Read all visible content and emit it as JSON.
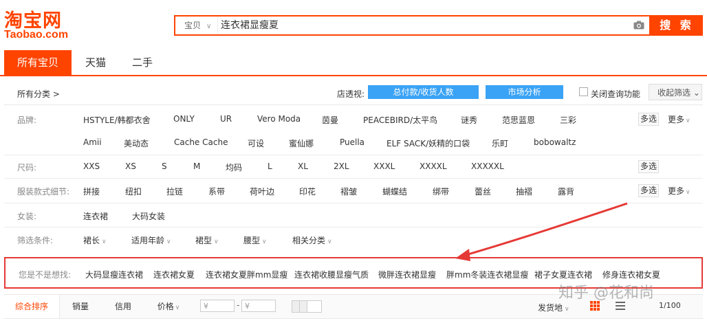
{
  "logo": {
    "cn": "淘宝网",
    "en": "Taobao.com"
  },
  "search": {
    "scope": "宝贝",
    "query": "连衣裙显瘦夏",
    "button": "搜 索"
  },
  "tabs": [
    "所有宝贝",
    "天猫",
    "二手"
  ],
  "breadcrumb": "所有分类 >",
  "store_view": {
    "label": "店透视:",
    "btn1": "总付款/收货人数",
    "btn2": "市场分析"
  },
  "close_query": "关闭查询功能",
  "collapse": "收起筛选 ⌄",
  "filters": {
    "brand": {
      "label": "品牌:",
      "row1": [
        "HSTYLE/韩都衣舍",
        "ONLY",
        "UR",
        "Vero Moda",
        "茵曼",
        "PEACEBIRD/太平鸟",
        "谜秀",
        "范思蓝恩",
        "三彩"
      ],
      "row2": [
        "Amii",
        "美动态",
        "Cache Cache",
        "可设",
        "蜜仙娜",
        "Puella",
        "ELF SACK/妖精的口袋",
        "乐町",
        "bobowaltz"
      ]
    },
    "size": {
      "label": "尺码:",
      "items": [
        "XXS",
        "XS",
        "S",
        "M",
        "均码",
        "L",
        "XL",
        "2XL",
        "XXXL",
        "XXXXL",
        "XXXXXL"
      ]
    },
    "detail": {
      "label": "服装款式细节:",
      "items": [
        "拼接",
        "纽扣",
        "拉链",
        "系带",
        "荷叶边",
        "印花",
        "褶皱",
        "蝴蝶结",
        "绑带",
        "蕾丝",
        "抽褶",
        "露背"
      ]
    },
    "womens": {
      "label": "女装:",
      "items": [
        "连衣裙",
        "大码女装"
      ]
    },
    "conditions": {
      "label": "筛选条件:",
      "items": [
        "裙长",
        "适用年龄",
        "裙型",
        "腰型",
        "相关分类"
      ]
    },
    "multi": "多选",
    "more": "更多"
  },
  "suggest": {
    "label": "您是不是想找:",
    "items": [
      "大码显瘦连衣裙",
      "连衣裙女夏",
      "连衣裙女夏胖mm显瘦",
      "连衣裙收腰显瘦气质",
      "微胖连衣裙显瘦",
      "胖mm冬装连衣裙显瘦",
      "裙子女夏连衣裙",
      "修身连衣裙女夏"
    ]
  },
  "sort": {
    "items": [
      "综合排序",
      "销量",
      "信用",
      "价格"
    ],
    "price_from": "¥",
    "price_to": "¥",
    "ship_from": "发货地",
    "page": "1/100"
  },
  "watermark": "知乎 @花和尚",
  "colors": {
    "accent": "#ff4400",
    "blue": "#3aa3f5",
    "highlight": "#e53935"
  }
}
